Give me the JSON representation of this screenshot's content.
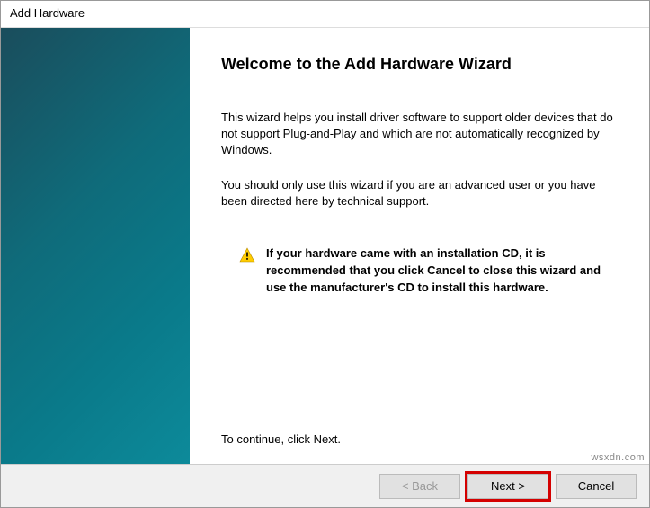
{
  "window": {
    "title": "Add Hardware"
  },
  "content": {
    "heading": "Welcome to the Add Hardware Wizard",
    "para1": "This wizard helps you install driver software to support older devices that do not support Plug-and-Play and which are not automatically recognized by Windows.",
    "para2": "You should only use this wizard if you are an advanced user or you have been directed here by technical support.",
    "warning": "If your hardware came with an installation CD, it is recommended that you click Cancel to close this wizard and use the manufacturer's CD to install this hardware.",
    "continue": "To continue, click Next."
  },
  "buttons": {
    "back": "< Back",
    "next": "Next >",
    "cancel": "Cancel"
  },
  "watermark": "wsxdn.com"
}
